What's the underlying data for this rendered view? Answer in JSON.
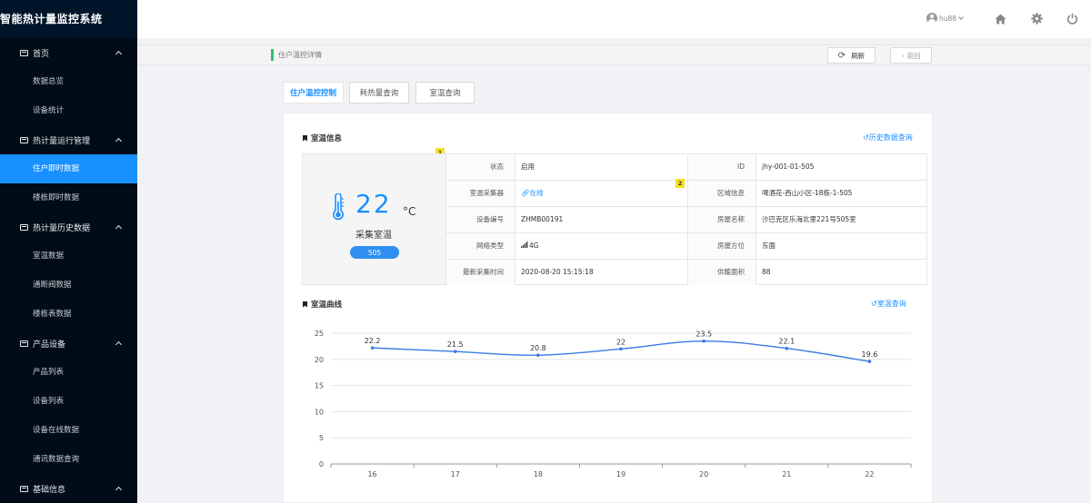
{
  "app": {
    "title": "智能热计量监控系统"
  },
  "sidebar": {
    "groups": [
      {
        "label": "首页",
        "items": [
          "数据总览",
          "设备统计"
        ]
      },
      {
        "label": "热计量运行管理",
        "items": [
          "住户即时数据",
          "楼栋即时数据"
        ]
      },
      {
        "label": "热计量历史数据",
        "items": [
          "室温数据",
          "通断阀数据",
          "楼栋表数据"
        ]
      },
      {
        "label": "产品设备",
        "items": [
          "产品列表",
          "设备列表",
          "设备在线数据",
          "通讯数据查询"
        ]
      },
      {
        "label": "基础信息",
        "items": []
      }
    ],
    "active_item": "住户即时数据"
  },
  "header": {
    "username": "hu88",
    "icons": [
      "user-icon",
      "home-icon",
      "gear-icon",
      "power-icon"
    ]
  },
  "breadcrumb": {
    "text": "住户温控详情",
    "refresh_label": "刷新",
    "back_label": "返回"
  },
  "tabs": [
    {
      "label": "住户温控控制",
      "active": true
    },
    {
      "label": "耗热量查询",
      "active": false
    },
    {
      "label": "室温查询",
      "active": false
    }
  ],
  "room_info": {
    "title": "室温信息",
    "history_link": "历史数据查询",
    "temperature": "22",
    "unit": "°C",
    "temp_label": "采集室温",
    "room_no": "505",
    "badges": [
      "1",
      "2"
    ],
    "rows": [
      {
        "l1": "状态",
        "v1": "启用",
        "l2": "ID",
        "v2": "jhy-001-01-505"
      },
      {
        "l1": "室温采集器",
        "v1": "在线",
        "l2": "区域信息",
        "v2": "啤酒花-西山小区-18栋-1-505"
      },
      {
        "l1": "设备编号",
        "v1": "ZHMB00191",
        "l2": "房屋名称",
        "v2": "沙巴克区乐海北里221号505室"
      },
      {
        "l1": "网络类型",
        "v1": "4G",
        "l2": "房屋方位",
        "v2": "东面"
      },
      {
        "l1": "最新采集时间",
        "v1": "2020-08-20 15:15:18",
        "l2": "供暖面积",
        "v2": "88"
      }
    ]
  },
  "chart_section": {
    "title": "室温曲线",
    "query_link": "室温查询"
  },
  "chart_data": {
    "type": "line",
    "categories": [
      "16",
      "17",
      "18",
      "19",
      "20",
      "21",
      "22"
    ],
    "values": [
      22.2,
      21.5,
      20.8,
      22,
      23.5,
      22.1,
      19.6
    ],
    "data_labels": [
      "22.2",
      "21.5",
      "20.8",
      "22",
      "23.5",
      "22.1",
      "19.6"
    ],
    "y_ticks": [
      "0",
      "5",
      "10",
      "15",
      "20",
      "25"
    ],
    "ylim": [
      0,
      25
    ],
    "line_color": "#3b7be6",
    "grid": true
  },
  "colors": {
    "accent": "#1890ff",
    "sidebar_bg": "#001529",
    "badge": "#f5e027"
  }
}
